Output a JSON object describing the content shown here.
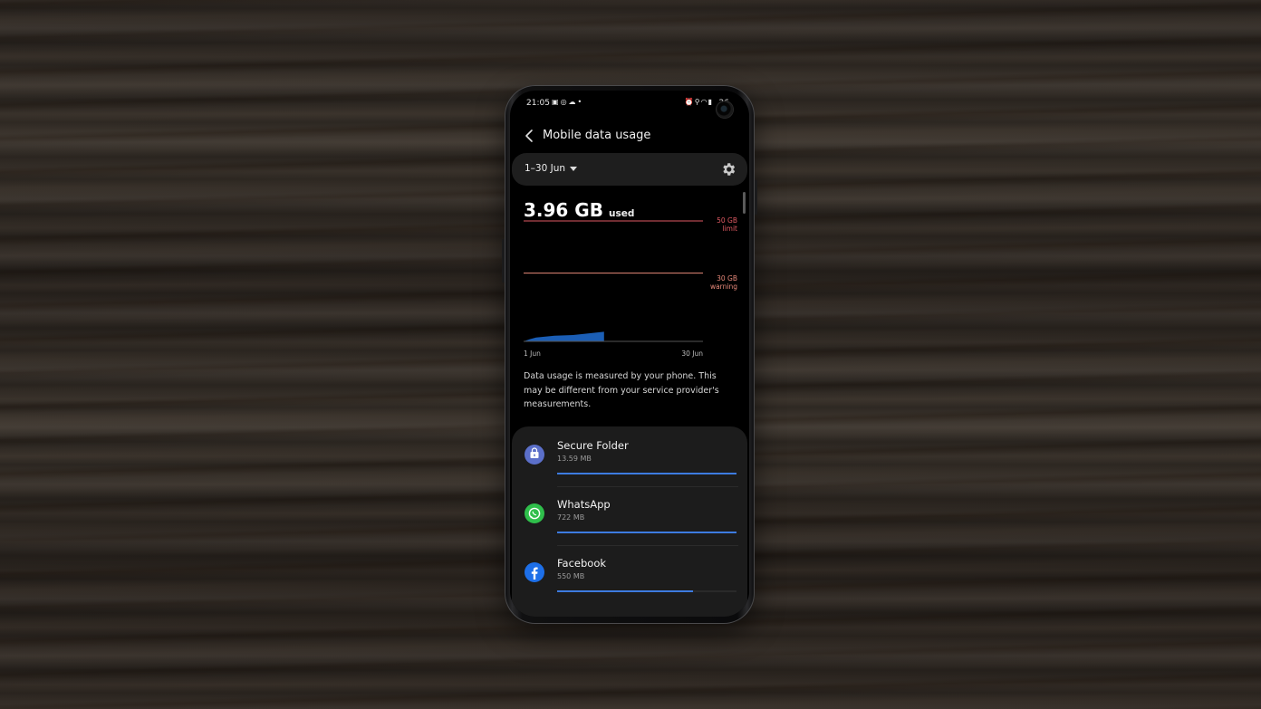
{
  "status_bar": {
    "time": "21:05",
    "left_icons": [
      "gallery-icon",
      "whatsapp-icon",
      "weather-icon",
      "dot-icon"
    ],
    "right_icons": [
      "alarm-icon",
      "location-icon",
      "wifi-icon",
      "signal-icon"
    ],
    "battery": "26"
  },
  "header": {
    "title": "Mobile data usage"
  },
  "cycle": {
    "label": "1–30 Jun"
  },
  "usage": {
    "value": "3.96 GB",
    "unit": "used"
  },
  "chart_data": {
    "type": "area",
    "x_start_label": "1 Jun",
    "x_end_label": "30 Jun",
    "limit": {
      "value_line1": "50 GB",
      "value_line2": "limit",
      "gb": 50
    },
    "warning": {
      "value_line1": "30 GB",
      "value_line2": "warning",
      "gb": 30
    },
    "ylim": [
      0,
      50
    ],
    "series": [
      {
        "x": [
          1,
          2,
          3,
          6,
          9,
          14
        ],
        "y": [
          0,
          0.9,
          1.6,
          2.3,
          2.6,
          3.96
        ]
      }
    ],
    "colors": {
      "limit": "#e05a63",
      "warning": "#e8897a",
      "area": "#1b5eb5",
      "baseline": "#555555"
    }
  },
  "note": "Data usage is measured by your phone. This may be different from your service provider's measurements.",
  "apps": [
    {
      "name": "Secure Folder",
      "size": "13.59 MB",
      "fraction": 1.0,
      "icon": "secure-folder-icon"
    },
    {
      "name": "WhatsApp",
      "size": "722 MB",
      "fraction": 1.0,
      "icon": "whatsapp-icon"
    },
    {
      "name": "Facebook",
      "size": "550 MB",
      "fraction": 0.76,
      "icon": "facebook-icon"
    }
  ],
  "colors": {
    "accent_bar": "#3d7be0",
    "background": "#000000"
  }
}
